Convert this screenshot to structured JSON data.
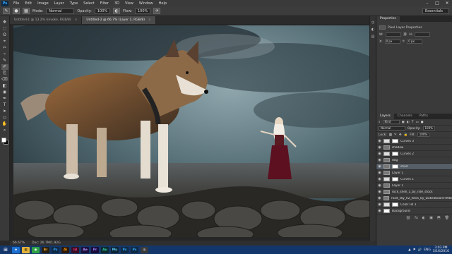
{
  "app": {
    "logo": "Ps"
  },
  "menu": [
    "File",
    "Edit",
    "Image",
    "Layer",
    "Type",
    "Select",
    "Filter",
    "3D",
    "View",
    "Window",
    "Help"
  ],
  "window_controls": [
    "–",
    "□",
    "✕"
  ],
  "options_bar": {
    "mode_label": "Mode:",
    "mode_value": "Normal",
    "opacity_label": "Opacity:",
    "opacity_value": "100%",
    "flow_label": "Flow:",
    "flow_value": "100%",
    "workspace": "Essentials"
  },
  "tabs": [
    {
      "label": "Untitled-1 @ 13.2% (invoke, RGB/8)",
      "active": false
    },
    {
      "label": "Untitled-2 @ 66.7% (Layer 1, RGB/8)",
      "active": true
    }
  ],
  "tools": [
    "✥",
    "⬚",
    "ʘ",
    "⌖",
    "✂",
    "⌁",
    "✎",
    "✐",
    "⎘",
    "⌫",
    "◧",
    "◉",
    "✒",
    "T",
    "➤",
    "▭",
    "✋",
    "⌕"
  ],
  "status": {
    "zoom": "66.67%",
    "doc": "Doc: 26.7M/1.92G"
  },
  "properties": {
    "tabs": [
      "Properties"
    ],
    "title": "Pixel Layer Properties",
    "w_label": "W:",
    "h_label": "H:",
    "x_label": "X:",
    "y_label": "Y:",
    "x_value": "0 px",
    "y_value": "0 px"
  },
  "layers_panel": {
    "tabs": [
      "Layers",
      "Channels",
      "Paths"
    ],
    "kind_label": "Kind",
    "blend_mode": "Normal",
    "opacity_label": "Opacity:",
    "opacity_value": "100%",
    "lock_label": "Lock:",
    "fill_label": "Fill:",
    "fill_value": "100%",
    "layers": [
      {
        "name": "Curves 3",
        "kind": "adj",
        "selected": false
      },
      {
        "name": "shadow",
        "kind": "pix",
        "selected": false
      },
      {
        "name": "Curves 2",
        "kind": "adj",
        "selected": false
      },
      {
        "name": "dog",
        "kind": "pix",
        "selected": false
      },
      {
        "name": "shad",
        "kind": "pix",
        "selected": true
      },
      {
        "name": "Layer 1",
        "kind": "pix",
        "selected": false
      },
      {
        "name": "Curves 1",
        "kind": "adj",
        "selected": false
      },
      {
        "name": "Layer 1",
        "kind": "pix",
        "selected": false
      },
      {
        "name": "rock_shell_1_by_ride_stock",
        "kind": "pix",
        "selected": false
      },
      {
        "name": "road_sky_02_tolos_by_wakeaboard-d98abaz",
        "kind": "pix",
        "selected": false
      },
      {
        "name": "Color Fill 1",
        "kind": "adj",
        "selected": false
      },
      {
        "name": "Background",
        "kind": "pix",
        "selected": false
      }
    ],
    "footer_icons": [
      "⛓",
      "fx",
      "◐",
      "▣",
      "⬒",
      "🗑"
    ]
  },
  "taskbar": {
    "start": "⊞",
    "apps": [
      {
        "label": "e",
        "color": "#1c6fd1",
        "fg": "#ffffff"
      },
      {
        "label": "▦",
        "color": "#e2b23a",
        "fg": "#3a2a00"
      },
      {
        "label": "◉",
        "color": "#2ea043",
        "fg": "#ffffff"
      },
      {
        "label": "Br",
        "color": "#2a1f0c",
        "fg": "#e8a23a"
      },
      {
        "label": "Ps",
        "color": "#0f2a44",
        "fg": "#31a8ff"
      },
      {
        "label": "Ai",
        "color": "#2f1a0a",
        "fg": "#ff9a00"
      },
      {
        "label": "Id",
        "color": "#3a0e22",
        "fg": "#ff3d8b"
      },
      {
        "label": "Ae",
        "color": "#1c0f3a",
        "fg": "#b597ff"
      },
      {
        "label": "Pr",
        "color": "#1a0c3a",
        "fg": "#9f8cff"
      },
      {
        "label": "Au",
        "color": "#0c2a2a",
        "fg": "#35d4b4"
      },
      {
        "label": "Mu",
        "color": "#0e2433",
        "fg": "#5ad1ff"
      },
      {
        "label": "Ps",
        "color": "#0f2a44",
        "fg": "#31a8ff"
      },
      {
        "label": "Ps",
        "color": "#0f2a44",
        "fg": "#31a8ff"
      },
      {
        "label": "◍",
        "color": "#3b3b3b",
        "fg": "#cccccc"
      }
    ],
    "tray_icons": [
      "▲",
      "⚑",
      "🔊",
      "ENG"
    ],
    "time": "3:03 PM",
    "date": "5/16/2016"
  }
}
